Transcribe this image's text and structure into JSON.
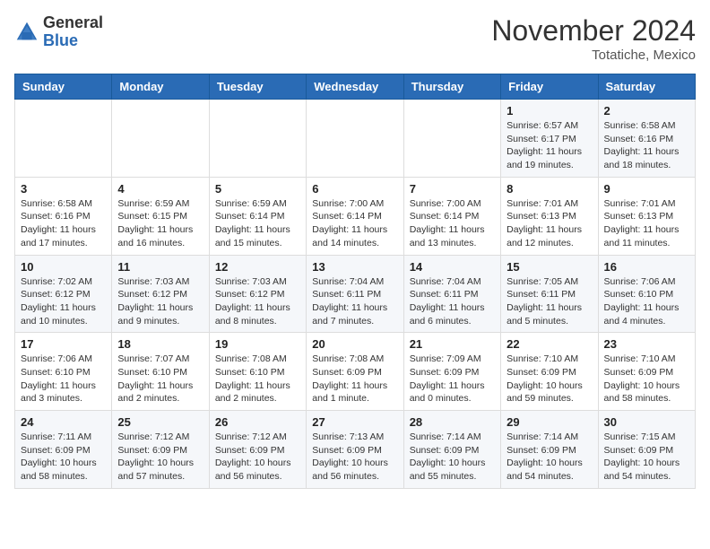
{
  "header": {
    "logo_general": "General",
    "logo_blue": "Blue",
    "month_title": "November 2024",
    "location": "Totatiche, Mexico"
  },
  "weekdays": [
    "Sunday",
    "Monday",
    "Tuesday",
    "Wednesday",
    "Thursday",
    "Friday",
    "Saturday"
  ],
  "weeks": [
    [
      {
        "day": "",
        "info": ""
      },
      {
        "day": "",
        "info": ""
      },
      {
        "day": "",
        "info": ""
      },
      {
        "day": "",
        "info": ""
      },
      {
        "day": "",
        "info": ""
      },
      {
        "day": "1",
        "info": "Sunrise: 6:57 AM\nSunset: 6:17 PM\nDaylight: 11 hours and 19 minutes."
      },
      {
        "day": "2",
        "info": "Sunrise: 6:58 AM\nSunset: 6:16 PM\nDaylight: 11 hours and 18 minutes."
      }
    ],
    [
      {
        "day": "3",
        "info": "Sunrise: 6:58 AM\nSunset: 6:16 PM\nDaylight: 11 hours and 17 minutes."
      },
      {
        "day": "4",
        "info": "Sunrise: 6:59 AM\nSunset: 6:15 PM\nDaylight: 11 hours and 16 minutes."
      },
      {
        "day": "5",
        "info": "Sunrise: 6:59 AM\nSunset: 6:14 PM\nDaylight: 11 hours and 15 minutes."
      },
      {
        "day": "6",
        "info": "Sunrise: 7:00 AM\nSunset: 6:14 PM\nDaylight: 11 hours and 14 minutes."
      },
      {
        "day": "7",
        "info": "Sunrise: 7:00 AM\nSunset: 6:14 PM\nDaylight: 11 hours and 13 minutes."
      },
      {
        "day": "8",
        "info": "Sunrise: 7:01 AM\nSunset: 6:13 PM\nDaylight: 11 hours and 12 minutes."
      },
      {
        "day": "9",
        "info": "Sunrise: 7:01 AM\nSunset: 6:13 PM\nDaylight: 11 hours and 11 minutes."
      }
    ],
    [
      {
        "day": "10",
        "info": "Sunrise: 7:02 AM\nSunset: 6:12 PM\nDaylight: 11 hours and 10 minutes."
      },
      {
        "day": "11",
        "info": "Sunrise: 7:03 AM\nSunset: 6:12 PM\nDaylight: 11 hours and 9 minutes."
      },
      {
        "day": "12",
        "info": "Sunrise: 7:03 AM\nSunset: 6:12 PM\nDaylight: 11 hours and 8 minutes."
      },
      {
        "day": "13",
        "info": "Sunrise: 7:04 AM\nSunset: 6:11 PM\nDaylight: 11 hours and 7 minutes."
      },
      {
        "day": "14",
        "info": "Sunrise: 7:04 AM\nSunset: 6:11 PM\nDaylight: 11 hours and 6 minutes."
      },
      {
        "day": "15",
        "info": "Sunrise: 7:05 AM\nSunset: 6:11 PM\nDaylight: 11 hours and 5 minutes."
      },
      {
        "day": "16",
        "info": "Sunrise: 7:06 AM\nSunset: 6:10 PM\nDaylight: 11 hours and 4 minutes."
      }
    ],
    [
      {
        "day": "17",
        "info": "Sunrise: 7:06 AM\nSunset: 6:10 PM\nDaylight: 11 hours and 3 minutes."
      },
      {
        "day": "18",
        "info": "Sunrise: 7:07 AM\nSunset: 6:10 PM\nDaylight: 11 hours and 2 minutes."
      },
      {
        "day": "19",
        "info": "Sunrise: 7:08 AM\nSunset: 6:10 PM\nDaylight: 11 hours and 2 minutes."
      },
      {
        "day": "20",
        "info": "Sunrise: 7:08 AM\nSunset: 6:09 PM\nDaylight: 11 hours and 1 minute."
      },
      {
        "day": "21",
        "info": "Sunrise: 7:09 AM\nSunset: 6:09 PM\nDaylight: 11 hours and 0 minutes."
      },
      {
        "day": "22",
        "info": "Sunrise: 7:10 AM\nSunset: 6:09 PM\nDaylight: 10 hours and 59 minutes."
      },
      {
        "day": "23",
        "info": "Sunrise: 7:10 AM\nSunset: 6:09 PM\nDaylight: 10 hours and 58 minutes."
      }
    ],
    [
      {
        "day": "24",
        "info": "Sunrise: 7:11 AM\nSunset: 6:09 PM\nDaylight: 10 hours and 58 minutes."
      },
      {
        "day": "25",
        "info": "Sunrise: 7:12 AM\nSunset: 6:09 PM\nDaylight: 10 hours and 57 minutes."
      },
      {
        "day": "26",
        "info": "Sunrise: 7:12 AM\nSunset: 6:09 PM\nDaylight: 10 hours and 56 minutes."
      },
      {
        "day": "27",
        "info": "Sunrise: 7:13 AM\nSunset: 6:09 PM\nDaylight: 10 hours and 56 minutes."
      },
      {
        "day": "28",
        "info": "Sunrise: 7:14 AM\nSunset: 6:09 PM\nDaylight: 10 hours and 55 minutes."
      },
      {
        "day": "29",
        "info": "Sunrise: 7:14 AM\nSunset: 6:09 PM\nDaylight: 10 hours and 54 minutes."
      },
      {
        "day": "30",
        "info": "Sunrise: 7:15 AM\nSunset: 6:09 PM\nDaylight: 10 hours and 54 minutes."
      }
    ]
  ]
}
